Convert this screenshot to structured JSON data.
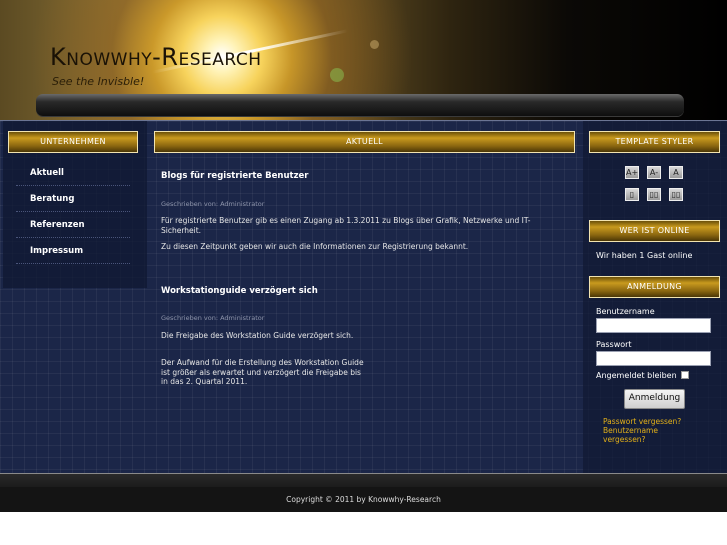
{
  "header": {
    "site_title": "Knowwhy-Research",
    "slogan": "See the Invisble!"
  },
  "left": {
    "heading": "UNTERNEHMEN",
    "nav": [
      {
        "label": "Aktuell"
      },
      {
        "label": "Beratung"
      },
      {
        "label": "Referenzen"
      },
      {
        "label": "Impressum"
      }
    ]
  },
  "center": {
    "heading": "AKTUELL",
    "posts": [
      {
        "title": "Blogs für registrierte Benutzer",
        "meta": "Geschrieben von: Administrator",
        "paragraphs": [
          "Für registrierte Benutzer gib es einen Zugang ab 1.3.2011 zu Blogs über Grafik, Netzwerke und IT-Sicherheit.",
          "Zu diesen Zeitpunkt geben wir auch die Informationen zur Registrierung bekannt."
        ]
      },
      {
        "title": "Workstationguide verzögert sich",
        "meta": "Geschrieben von: Administrator",
        "paragraphs": [
          "Die Freigabe des Workstation Guide verzögert sich.",
          "Der Aufwand für die Erstellung des Workstation Guide ist größer als erwartet und verzögert die Freigabe bis in das 2. Quartal 2011."
        ]
      }
    ]
  },
  "right": {
    "styler_heading": "TEMPLATE STYLER",
    "font_buttons": [
      "A+",
      "A-",
      "A"
    ],
    "layout_buttons": [
      "▯",
      "▯▯",
      "▯▯"
    ],
    "online_heading": "WER IST ONLINE",
    "online_text": "Wir haben 1 Gast online",
    "login_heading": "ANMELDUNG",
    "username_label": "Benutzername",
    "username_value": "",
    "password_label": "Passwort",
    "password_value": "",
    "remember_label": "Angemeldet bleiben",
    "remember_checked": false,
    "login_button": "Anmeldung",
    "forgot_password": "Passwort vergessen?",
    "forgot_username_1": "Benutzername",
    "forgot_username_2": "vergessen?"
  },
  "footer": {
    "copyright": "Copyright © 2011 by Knowwhy-Research"
  },
  "colors": {
    "background": "#1b2648",
    "gold": "#c99a1e",
    "link": "#e2b019"
  }
}
